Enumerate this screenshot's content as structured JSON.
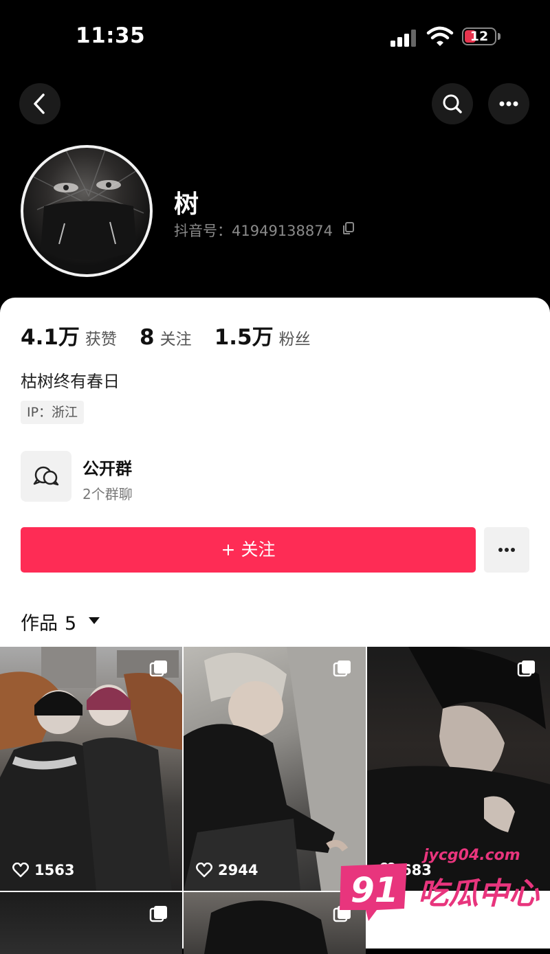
{
  "status_bar": {
    "time": "11:35",
    "battery": "12"
  },
  "profile": {
    "nickname": "树",
    "douyin_id": "抖音号：41949138874"
  },
  "stats": [
    {
      "value": "4.1万",
      "label": "获赞"
    },
    {
      "value": "8",
      "label": "关注"
    },
    {
      "value": "1.5万",
      "label": "粉丝"
    }
  ],
  "bio": "枯树终有春日",
  "ip": "IP：浙江",
  "group": {
    "title": "公开群",
    "subtitle": "2个群聊"
  },
  "follow_button": "+ 关注",
  "works": {
    "label": "作品",
    "count": "5"
  },
  "videos": [
    {
      "likes": "1563"
    },
    {
      "likes": "2944"
    },
    {
      "likes": "683"
    }
  ],
  "watermark": {
    "url": "jycg04.com",
    "text": "吃瓜中心",
    "number": "91"
  },
  "colors": {
    "accent": "#fe2c55",
    "watermark": "#e8357d"
  }
}
